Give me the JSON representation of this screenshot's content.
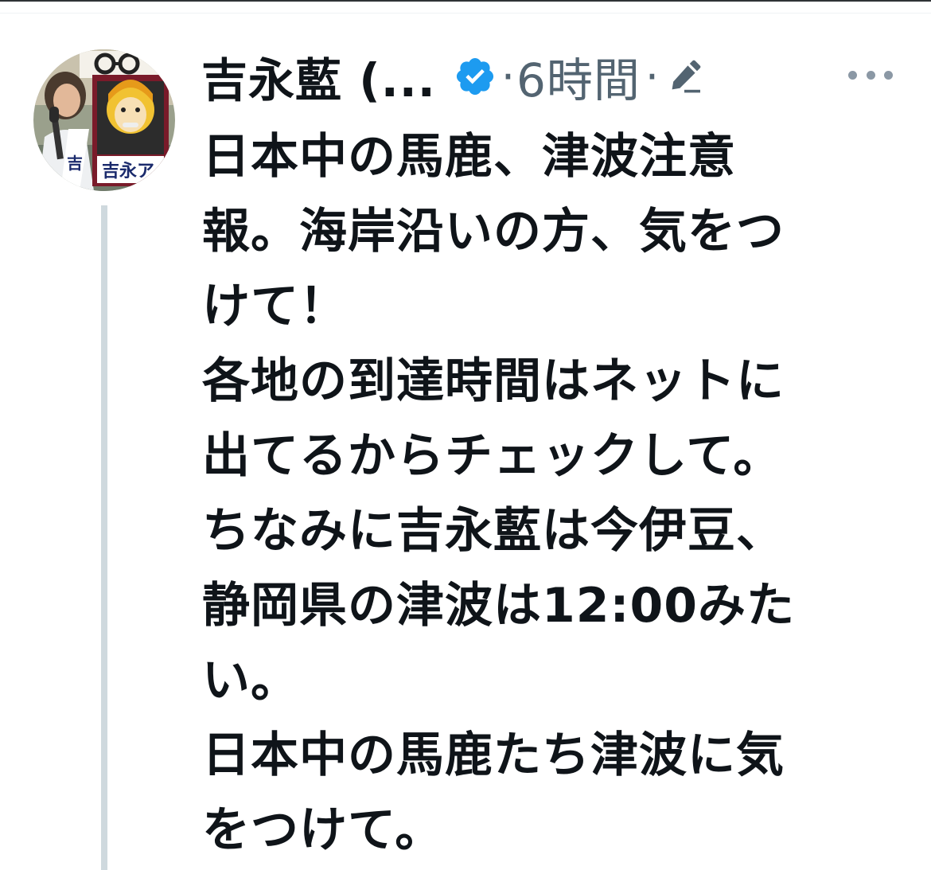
{
  "tweet": {
    "author": {
      "display_name": "吉永藍 (...",
      "avatar": "profile-photo",
      "verified": true
    },
    "separator": "·",
    "timestamp": "6時間",
    "edited": true,
    "more_icon": "ellipsis-icon",
    "text": "日本中の馬鹿、津波注意\n報。海岸沿いの方、気をつ\nけて！\n各地の到達時間はネットに\n出てるからチェックして。\nちなみに吉永藍は今伊豆、\n静岡県の津波は12:00みた\nい。\n日本中の馬鹿たち津波に気\nをつけて。"
  },
  "colors": {
    "text_primary": "#0f1419",
    "text_secondary": "#536471",
    "verified_blue": "#1d9bf0",
    "thread_line": "#cfd9de"
  }
}
